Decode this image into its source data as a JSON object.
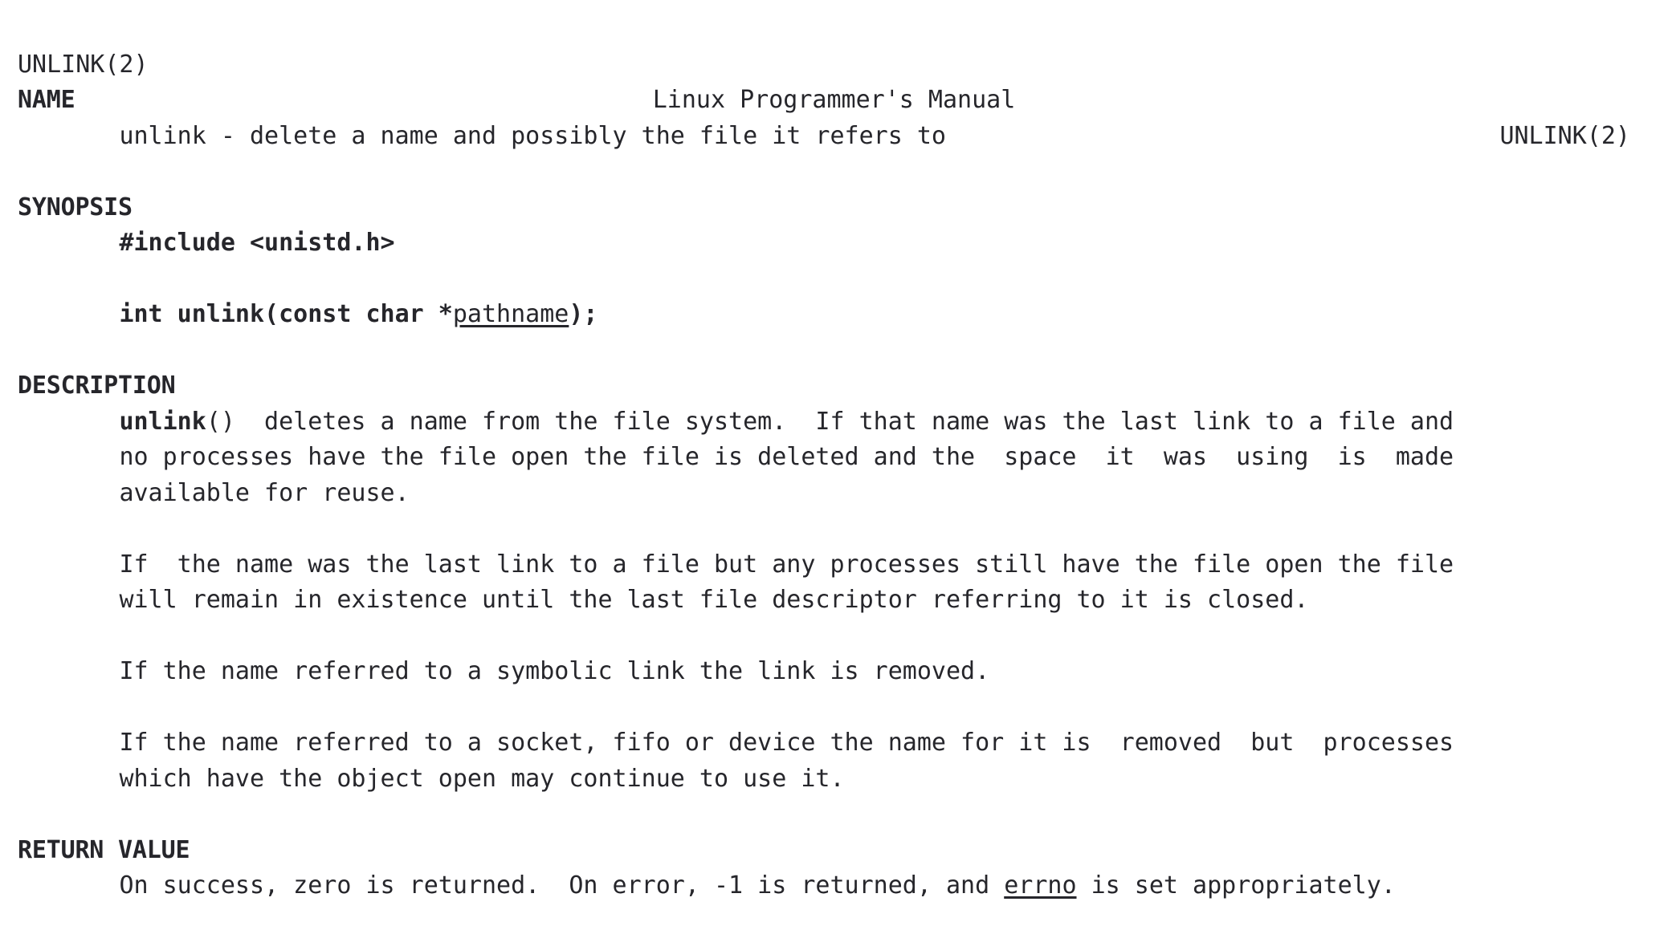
{
  "document": {
    "kind": "man-page",
    "title": "UNLINK(2)",
    "header": {
      "left": "UNLINK(2)",
      "center": "Linux Programmer's Manual",
      "right": "UNLINK(2)"
    },
    "colors": {
      "background": "#ffffff",
      "text": "#26262b"
    },
    "sections": [
      {
        "heading": "NAME",
        "lines": [
          "       unlink - delete a name and possibly the file it refers to"
        ]
      },
      {
        "heading": "SYNOPSIS",
        "lines": [
          "       #include <unistd.h>",
          "",
          "       int unlink(const char *pathname);"
        ]
      },
      {
        "heading": "DESCRIPTION",
        "lines": [
          "       unlink()  deletes a name from the file system.  If that name was the last link to a file and",
          "       no processes have the file open the file is deleted and the  space  it  was  using  is  made",
          "       available for reuse.",
          "",
          "       If  the name was the last link to a file but any processes still have the file open the file",
          "       will remain in existence until the last file descriptor referring to it is closed.",
          "",
          "       If the name referred to a symbolic link the link is removed.",
          "",
          "       If the name referred to a socket, fifo or device the name for it is  removed  but  processes",
          "       which have the object open may continue to use it."
        ]
      },
      {
        "heading": "RETURN VALUE",
        "lines": [
          "       On success, zero is returned.  On error, -1 is returned, and errno is set appropriately."
        ]
      }
    ],
    "fragments": {
      "name_indent": "       ",
      "synopsis_include": "#include <unistd.h>",
      "proto_prefix": "int unlink(const char *",
      "proto_param": "pathname",
      "proto_suffix": ");",
      "desc_func_bold": "unlink",
      "desc_func_parens": "()",
      "desc_l1_rest": "  deletes a name from the file system.  If that name was the last link to a file and",
      "desc_l2": "no processes have the file open the file is deleted and the  space  it  was  using  is  made",
      "desc_l3": "available for reuse.",
      "desc_p2_l1": "If  the name was the last link to a file but any processes still have the file open the file",
      "desc_p2_l2": "will remain in existence until the last file descriptor referring to it is closed.",
      "desc_p3_l1": "If the name referred to a symbolic link the link is removed.",
      "desc_p4_l1": "If the name referred to a socket, fifo or device the name for it is  removed  but  processes",
      "desc_p4_l2": "which have the object open may continue to use it.",
      "rv_pre": "On success, zero is returned.  On error, -1 is returned, and ",
      "rv_errno": "errno",
      "rv_post": " is set appropriately."
    }
  }
}
